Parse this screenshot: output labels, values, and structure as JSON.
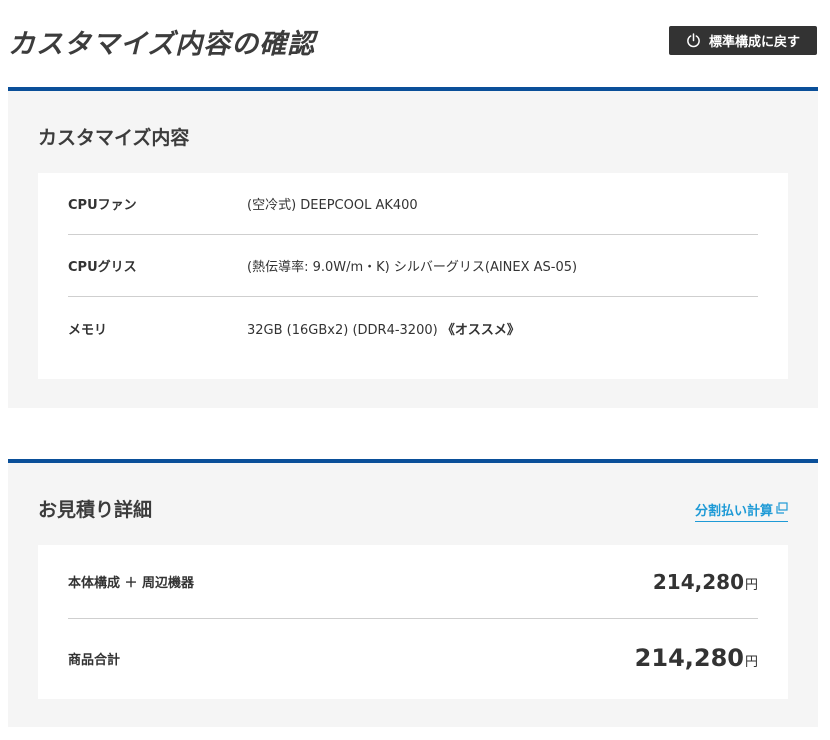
{
  "page": {
    "title": "カスタマイズ内容の確認",
    "reset_label": "標準構成に戻す",
    "reset_icon": "power-icon"
  },
  "customization": {
    "heading": "カスタマイズ内容",
    "rows": [
      {
        "label": "CPUファン",
        "value": "(空冷式) DEEPCOOL AK400",
        "emphasis": ""
      },
      {
        "label": "CPUグリス",
        "value": "(熱伝導率: 9.0W/m・K) シルバーグリス(AINEX AS-05)",
        "emphasis": ""
      },
      {
        "label": "メモリ",
        "value": "32GB (16GBx2) (DDR4-3200) ",
        "emphasis": "《オススメ》"
      }
    ]
  },
  "estimate": {
    "heading": "お見積り詳細",
    "installment_link": "分割払い計算",
    "installment_icon": "external-window-icon",
    "subtotal_label": "本体構成 ＋ 周辺機器",
    "subtotal_value": "214,280",
    "total_label": "商品合計",
    "total_value": "214,280",
    "currency": "円"
  },
  "colors": {
    "accent_border": "#0a4f99",
    "link": "#1e9ad6",
    "button_bg": "#333333",
    "panel_bg": "#f5f5f5"
  }
}
